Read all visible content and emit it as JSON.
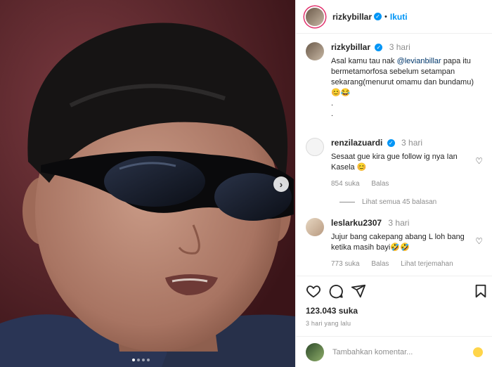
{
  "post": {
    "username": "rizkybillar",
    "follow_label": "Ikuti",
    "separator": "•",
    "caption_time": "3 hari",
    "caption_line1_prefix": "Asal kamu tau nak ",
    "caption_mention": "@levianbillar",
    "caption_line1_suffix": " papa itu bermetamorfosa sebelum setampan sekarang(menurut omamu dan bundamu) 😊😂",
    "caption_dots": ".\n.",
    "likes": "123.043 suka",
    "date": "3 hari yang lalu"
  },
  "comments": [
    {
      "username": "renzilazuardi",
      "time": "3 hari",
      "text": "Sesaat gue kira gue follow ig nya Ian Kasela 😊",
      "likes": "854 suka",
      "reply_label": "Balas"
    },
    {
      "username": "leslarku2307",
      "time": "3 hari",
      "text": "Jujur bang cakepang abang L loh bang ketika masih bayi🤣🤣",
      "likes": "773 suka",
      "reply_label": "Balas",
      "translate_label": "Lihat terjemahan"
    }
  ],
  "view_replies_label": "Lihat semua 45 balasan",
  "add_comment": {
    "placeholder": "Tambahkan komentar...",
    "post_label": ""
  },
  "carousel": {
    "total_slides": 4,
    "active_index": 0
  },
  "icons": [
    "heart-icon",
    "comment-icon",
    "share-icon",
    "bookmark-icon",
    "emoji-icon",
    "verified-icon",
    "chevron-right-icon"
  ],
  "colors": {
    "accent": "#0095f6",
    "muted": "#8e8e8e",
    "text": "#262626",
    "story_ring": "#e1306c"
  }
}
